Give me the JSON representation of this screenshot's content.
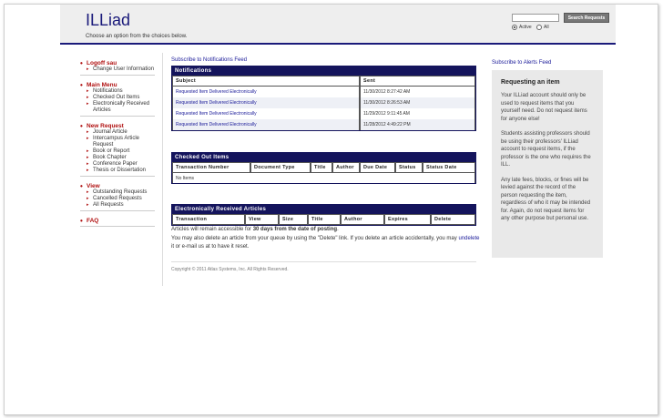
{
  "header": {
    "title": "ILLiad",
    "subtitle": "Choose an option from the choices below.",
    "search_button": "Search Requests",
    "radio_active": "Active",
    "radio_all": "All"
  },
  "nav": {
    "logoff": "Logoff sau",
    "logoff_items": [
      "Change User Information"
    ],
    "main_menu": "Main Menu",
    "main_items": [
      "Notifications",
      "Checked Out Items",
      "Electronically Received Articles"
    ],
    "new_request": "New Request",
    "new_items": [
      "Journal Article",
      "Intercampus Article Request",
      "Book or Report",
      "Book Chapter",
      "Conference Paper",
      "Thesis or Dissertation"
    ],
    "view": "View",
    "view_items": [
      "Outstanding Requests",
      "Cancelled Requests",
      "All Requests"
    ],
    "faq": "FAQ"
  },
  "notifications": {
    "feed_link": "Subscribe to Notifications Feed",
    "title": "Notifications",
    "col_subject": "Subject",
    "col_sent": "Sent",
    "rows": [
      {
        "subject": "Requested Item Delivered Electronically",
        "sent": "11/30/2012 8:27:42 AM"
      },
      {
        "subject": "Requested Item Delivered Electronically",
        "sent": "11/30/2012 8:26:53 AM"
      },
      {
        "subject": "Requested Item Delivered Electronically",
        "sent": "11/29/2012 9:11:45 AM"
      },
      {
        "subject": "Requested Item Delivered Electronically",
        "sent": "11/28/2012 4:49:22 PM"
      }
    ]
  },
  "checked_out": {
    "title": "Checked Out Items",
    "columns": [
      "Transaction Number",
      "Document Type",
      "Title",
      "Author",
      "Due Date",
      "Status",
      "Status Date"
    ],
    "empty": "No Items"
  },
  "electronic": {
    "title": "Electronically Received Articles",
    "columns": [
      "Transaction",
      "View",
      "Size",
      "Title",
      "Author",
      "Expires",
      "Delete"
    ],
    "note_pre": "Articles will remain accessible for ",
    "note_bold": "30 days from the date of posting",
    "note_post": ".",
    "delete_text": "You may also delete an article from your queue by using the \"Delete\" link. If you delete an article accidentally, you may ",
    "undelete": "undelete",
    "delete_text_end": " it or e-mail us at to have it reset."
  },
  "footer": {
    "copyright": "Copyright © 2011 Atlas Systems, Inc. All Rights Reserved."
  },
  "sidebar": {
    "alerts_link": "Subscribe to Alerts Feed",
    "title": "Requesting an item",
    "paragraphs": [
      "Your ILLiad account should only be used to request items that you yourself need. Do not request items for anyone else!",
      "Students assisting professors should be using their professors' ILLiad account to request items, if the professor is the one who requires the ILL.",
      "Any late fees, blocks, or fines will be levied against the record of the person requesting the item, regardless of who it may be intended for. Again, do not request items for any other purpose but personal use."
    ]
  },
  "colors": {
    "brand": "#1a1a7a",
    "accent_red": "#b01010",
    "table_header": "#14145c"
  }
}
